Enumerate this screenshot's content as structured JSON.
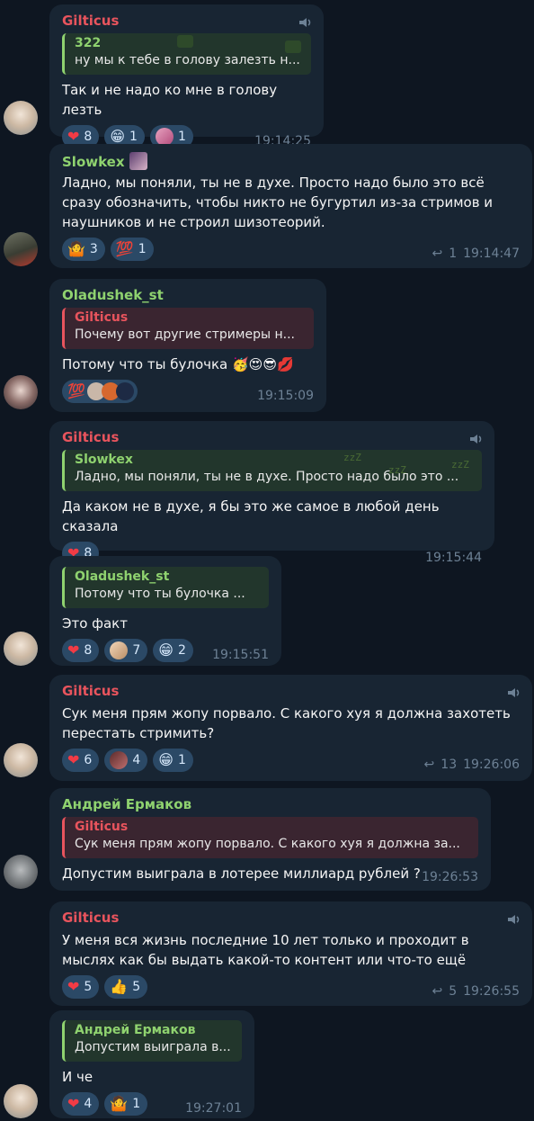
{
  "colors": {
    "background": "#0e1621",
    "bubble": "#182533",
    "reaction_bg": "#2b4966",
    "meta": "#6d8195",
    "red_name": "#e8545d",
    "green_name": "#8fd26f",
    "red_quote_bg": "#3a2530",
    "green_quote_bg": "#22362c"
  },
  "messages": [
    {
      "sender": "Gilticus",
      "reply": {
        "name": "322",
        "text": "ну мы к тебе в голову залезть н..."
      },
      "text": "Так и не надо ко мне в голову лезть",
      "reactions": [
        {
          "icon": "heart-icon",
          "glyph": "❤",
          "count": "8"
        },
        {
          "icon": "grin-emoji-icon",
          "glyph": "😁",
          "count": "1"
        },
        {
          "icon": "user-avatar-reaction",
          "count": "1"
        }
      ],
      "time": "19:14:25"
    },
    {
      "sender": "Slowkex",
      "text": "Ладно, мы поняли, ты не в духе. Просто надо было это всё сразу обозначить, чтобы никто не бугуртил из-за стримов и наушников и не строил шизотеорий.",
      "reactions": [
        {
          "icon": "shrug-emoji-icon",
          "glyph": "🤷",
          "count": "3"
        },
        {
          "icon": "hundred-emoji-icon",
          "glyph": "💯",
          "count": "1"
        }
      ],
      "replies_count": "1",
      "time": "19:14:47"
    },
    {
      "sender": "Oladushek_st",
      "reply": {
        "name": "Gilticus",
        "text": "Почему вот другие стримеры н..."
      },
      "text": "Потому что ты булочка 🥳😍😎💋",
      "reactions": [
        {
          "icon": "hundred-emoji-icon",
          "glyph": "💯"
        }
      ],
      "time": "19:15:09"
    },
    {
      "sender": "Gilticus",
      "reply": {
        "name": "Slowkex",
        "text": "Ладно, мы поняли, ты не в духе. Просто надо было это ..."
      },
      "text": "Да каком не в духе, я бы это же самое в любой день сказала",
      "reactions": [
        {
          "icon": "heart-icon",
          "glyph": "❤",
          "count": "8"
        }
      ],
      "time": "19:15:44"
    },
    {
      "reply": {
        "name": "Oladushek_st",
        "text": "Потому что ты булочка ..."
      },
      "text": "Это факт",
      "reactions": [
        {
          "icon": "heart-icon",
          "glyph": "❤",
          "count": "8"
        },
        {
          "icon": "user-avatar-reaction",
          "count": "7"
        },
        {
          "icon": "grin-emoji-icon",
          "glyph": "😁",
          "count": "2"
        }
      ],
      "time": "19:15:51"
    },
    {
      "sender": "Gilticus",
      "text": "Сук меня прям жопу порвало. С какого хуя я должна захотеть перестать стримить?",
      "reactions": [
        {
          "icon": "heart-icon",
          "glyph": "❤",
          "count": "6"
        },
        {
          "icon": "user-avatar-reaction",
          "count": "4"
        },
        {
          "icon": "grin-emoji-icon",
          "glyph": "😁",
          "count": "1"
        }
      ],
      "replies_count": "13",
      "time": "19:26:06"
    },
    {
      "sender": "Андрей Ермаков",
      "reply": {
        "name": "Gilticus",
        "text": "Сук меня прям жопу порвало. С какого хуя я должна за..."
      },
      "text": "Допустим выиграла в лотерее миллиард рублей ?",
      "time": "19:26:53"
    },
    {
      "sender": "Gilticus",
      "text": "У меня вся жизнь последние 10 лет только и проходит в мыслях как бы выдать какой-то контент или что-то ещё",
      "reactions": [
        {
          "icon": "heart-icon",
          "glyph": "❤",
          "count": "5"
        },
        {
          "icon": "thumbs-up-icon",
          "glyph": "👍",
          "count": "5"
        }
      ],
      "replies_count": "5",
      "time": "19:26:55"
    },
    {
      "reply": {
        "name": "Андрей Ермаков",
        "text": "Допустим выиграла в..."
      },
      "text": "И че",
      "reactions": [
        {
          "icon": "heart-icon",
          "glyph": "❤",
          "count": "4"
        },
        {
          "icon": "shrug-emoji-icon",
          "glyph": "🤷",
          "count": "1"
        }
      ],
      "time": "19:27:01"
    }
  ]
}
